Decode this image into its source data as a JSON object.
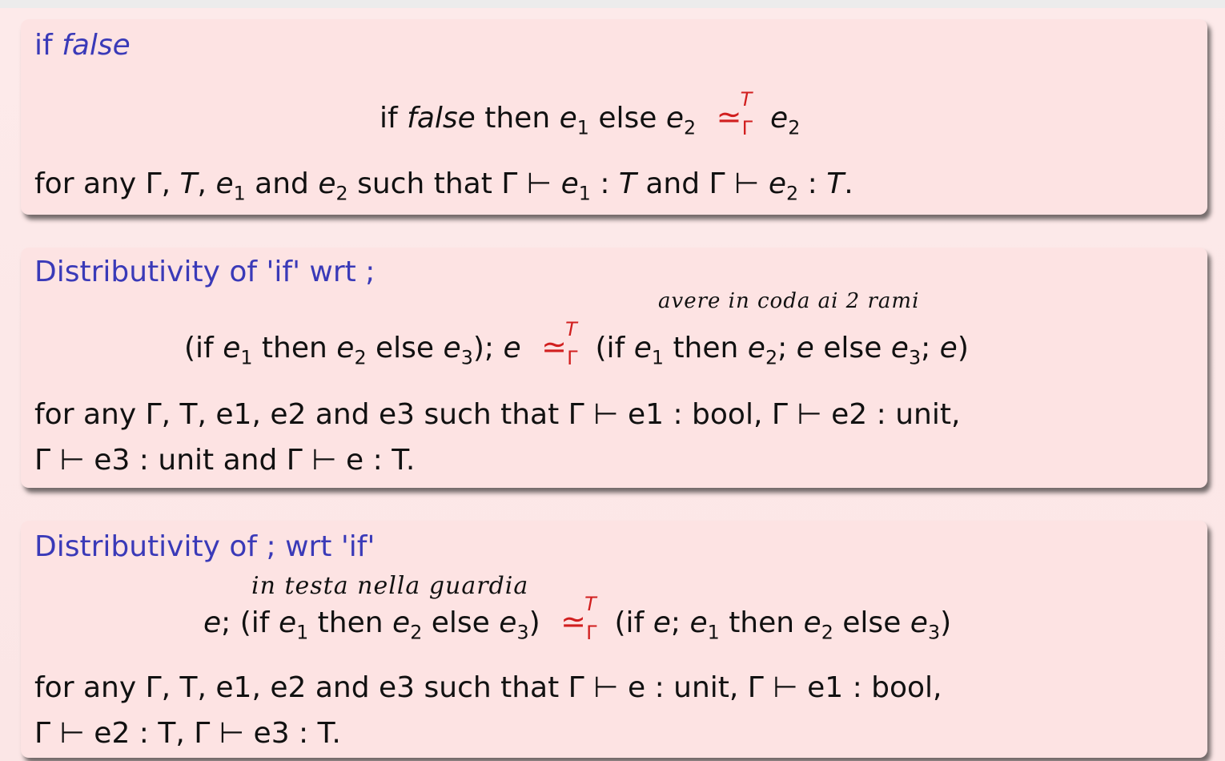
{
  "blocks": [
    {
      "title_word": "if",
      "title_italic": "false",
      "formula": {
        "w_if": "if",
        "w_false": "false",
        "w_then": "then",
        "e1": "e",
        "e1_sub": "1",
        "w_else": "else",
        "e2": "e",
        "e2_sub": "2",
        "rel_symbol": "≃",
        "rel_sup": "T",
        "rel_sub": "Γ",
        "rhs": "e",
        "rhs_sub": "2"
      },
      "condition_line1": {
        "p1": "for any Γ,",
        "T": "T",
        "c1": ",",
        "e1": "e",
        "e1_sub": "1",
        "and1": "and",
        "e2": "e",
        "e2_sub": "2",
        "p2": "such that Γ ⊢",
        "e1b": "e",
        "e1b_sub": "1",
        "colon1": ":",
        "T2": "T",
        "and2": "and Γ ⊢",
        "e2b": "e",
        "e2b_sub": "2",
        "colon2": ":",
        "T3": "T",
        "end": "."
      }
    },
    {
      "title": "Distributivity of 'if' wrt ;",
      "handwritten_note": "avere in coda ai 2 rami",
      "formula": {
        "lhs_open": "(if",
        "e1": "e",
        "e1_sub": "1",
        "then": "then",
        "e2": "e",
        "e2_sub": "2",
        "else": "else",
        "e3": "e",
        "e3_sub": "3",
        "close": ");",
        "e": "e",
        "rel_symbol": "≃",
        "rel_sup": "T",
        "rel_sub": "Γ",
        "rhs_open": "(if",
        "r_e1": "e",
        "r_e1_sub": "1",
        "r_then": "then",
        "r_e2": "e",
        "r_e2_sub": "2",
        "r_semi1": ";",
        "r_e_a": "e",
        "r_else": "else",
        "r_e3": "e",
        "r_e3_sub": "3",
        "r_semi2": ";",
        "r_e_b": "e",
        "rhs_close": ")"
      },
      "condition_line1": "for any Γ,  T, e1, e2 and e3 such that Γ ⊢ e1 : bool, Γ ⊢ e2 : unit,",
      "condition_line2": "Γ ⊢ e3 : unit and Γ ⊢ e : T."
    },
    {
      "title": "Distributivity of ; wrt 'if'",
      "handwritten_note": "in testa nella guardia",
      "formula": {
        "lhs_e": "e",
        "lhs_semi": ";",
        "lhs_open": "(if",
        "e1": "e",
        "e1_sub": "1",
        "then": "then",
        "e2": "e",
        "e2_sub": "2",
        "else": "else",
        "e3": "e",
        "e3_sub": "3",
        "close": ")",
        "rel_symbol": "≃",
        "rel_sup": "T",
        "rel_sub": "Γ",
        "rhs_open": "(if",
        "r_e": "e",
        "r_semi": ";",
        "r_e1": "e",
        "r_e1_sub": "1",
        "r_then": "then",
        "r_e2": "e",
        "r_e2_sub": "2",
        "r_else": "else",
        "r_e3": "e",
        "r_e3_sub": "3",
        "rhs_close": ")"
      },
      "condition_line1": "for any Γ,  T, e1, e2 and e3 such that Γ ⊢ e : unit, Γ ⊢ e1 : bool,",
      "condition_line2": "Γ ⊢ e2 : T, Γ ⊢ e3 : T."
    }
  ]
}
